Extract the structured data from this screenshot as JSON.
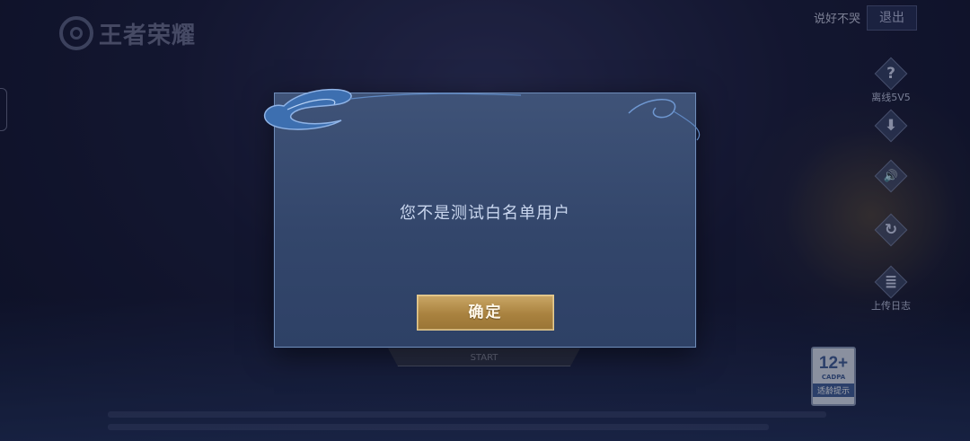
{
  "header": {
    "logo_text": "王者荣耀",
    "user_name": "说好不哭",
    "logout_label": "退出"
  },
  "side_menu": [
    {
      "icon": "question-icon",
      "glyph": "?",
      "label": "离线5V5"
    },
    {
      "icon": "download-icon",
      "glyph": "⬇",
      "label": ""
    },
    {
      "icon": "volume-icon",
      "glyph": "🔊",
      "label": ""
    },
    {
      "icon": "refresh-icon",
      "glyph": "↻",
      "label": ""
    },
    {
      "icon": "log-upload-icon",
      "glyph": "≣",
      "label": "上传日志"
    }
  ],
  "start_button": {
    "label": "START"
  },
  "age_rating": {
    "rating": "12+",
    "org": "CADPA",
    "tip": "适龄提示"
  },
  "dialog": {
    "message": "您不是测试白名单用户",
    "confirm_label": "确定"
  },
  "colors": {
    "dialog_bg": "#3a4e73",
    "dialog_border": "#6f8cb8",
    "confirm_button": "#b48c49",
    "message_text": "#c9d6ee"
  }
}
